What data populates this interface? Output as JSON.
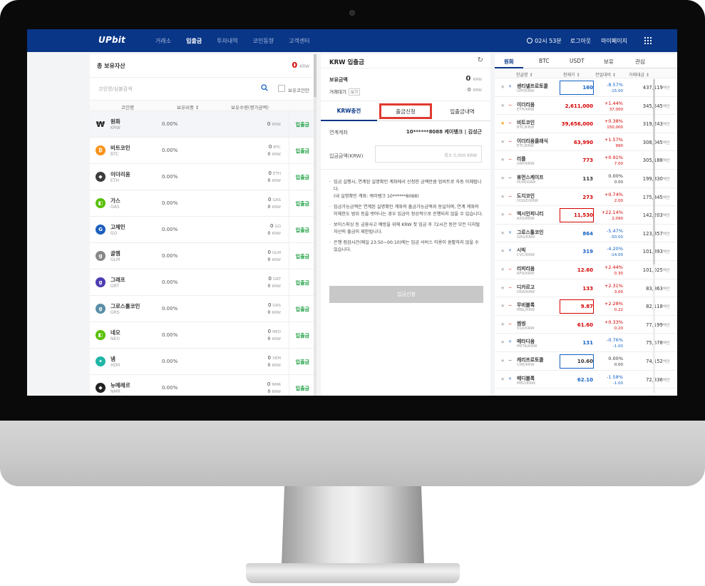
{
  "header": {
    "logo": "UPbit",
    "nav": [
      "거래소",
      "입출금",
      "투자내역",
      "코인동향",
      "고객센터"
    ],
    "active_nav": 1,
    "clock": "02시 53분",
    "logout": "로그아웃",
    "mypage": "마이페이지"
  },
  "assets": {
    "title": "총 보유자산",
    "total_value": "0",
    "total_unit": "KRW",
    "search_placeholder": "코인명/심볼검색",
    "owned_only_label": "보유코인만",
    "columns": [
      "코인명",
      "보유비중 ↕",
      "보유수량(평가금액)"
    ],
    "rows": [
      {
        "name": "원화",
        "symbol": "KRW",
        "pct": "0.00%",
        "amount": "0",
        "unit": "KRW",
        "krw": "",
        "action": "입출금",
        "icon": "won-icon",
        "color": "#222"
      },
      {
        "name": "비트코인",
        "symbol": "BTC",
        "pct": "0.00%",
        "amount": "0",
        "unit": "BTC",
        "krw": "0",
        "action": "입출금",
        "icon": "bitcoin-icon",
        "color": "#f7931a"
      },
      {
        "name": "이더리움",
        "symbol": "ETH",
        "pct": "0.00%",
        "amount": "0",
        "unit": "ETH",
        "krw": "0",
        "action": "입출금",
        "icon": "ethereum-icon",
        "color": "#3c3c3d"
      },
      {
        "name": "가스",
        "symbol": "GAS",
        "pct": "0.00%",
        "amount": "0",
        "unit": "GAS",
        "krw": "0",
        "action": "입출금",
        "icon": "gas-icon",
        "color": "#58bf00"
      },
      {
        "name": "고체인",
        "symbol": "GO",
        "pct": "0.00%",
        "amount": "0",
        "unit": "GO",
        "krw": "0",
        "action": "입출금",
        "icon": "gochain-icon",
        "color": "#1c5fbd"
      },
      {
        "name": "골렘",
        "symbol": "GLM",
        "pct": "0.00%",
        "amount": "0",
        "unit": "GLM",
        "krw": "0",
        "action": "입출금",
        "icon": "golem-icon",
        "color": "#888"
      },
      {
        "name": "그래프",
        "symbol": "GRT",
        "pct": "0.00%",
        "amount": "0",
        "unit": "GRT",
        "krw": "0",
        "action": "입출금",
        "icon": "graph-icon",
        "color": "#4a3bb0"
      },
      {
        "name": "그로스톨코인",
        "symbol": "GRS",
        "pct": "0.00%",
        "amount": "0",
        "unit": "GRS",
        "krw": "0",
        "action": "입출금",
        "icon": "groestlcoin-icon",
        "color": "#5a8fa6"
      },
      {
        "name": "네오",
        "symbol": "NEO",
        "pct": "0.00%",
        "amount": "0",
        "unit": "NEO",
        "krw": "0",
        "action": "입출금",
        "icon": "neo-icon",
        "color": "#58bf00"
      },
      {
        "name": "넴",
        "symbol": "XEM",
        "pct": "0.00%",
        "amount": "0",
        "unit": "XEM",
        "krw": "0",
        "action": "입출금",
        "icon": "nem-icon",
        "color": "#1fb5a6"
      },
      {
        "name": "뉴메레르",
        "symbol": "NMR",
        "pct": "0.00%",
        "amount": "0",
        "unit": "NMR",
        "krw": "0",
        "action": "입출금",
        "icon": "numeraire-icon",
        "color": "#222"
      }
    ]
  },
  "deposit": {
    "title": "KRW 입출금",
    "held_label": "보유금액",
    "held_value": "0",
    "held_unit": "KRW",
    "pending_label": "거래대기",
    "pending_btn": "보기",
    "pending_value": "0",
    "pending_unit": "KRW",
    "tabs": [
      "KRW충전",
      "출금신청",
      "입출금내역"
    ],
    "account_label": "연계계좌",
    "account_value": "10******8088 케이뱅크 | 김성근",
    "amount_label": "입금금액(KRW)",
    "amount_placeholder": "최소 5,000 KRW",
    "notes": [
      "입금 실행시, 연계된 실명확인 계좌에서 신청한 금액만큼 업비트로 자동 이체됩니다.",
      "(내 실명확인 계좌: 케이뱅크 10******8088)",
      "입금가능금액은 연계된 실명확인 계좌의 출금가능금액과 동일하며, 연계 계좌의 이체한도 범위 등을 벗어나는 경우 입금이 정상적으로 진행되지 않을 수 있습니다.",
      "보이스피싱 등 금융사고 예방을 위해 KRW 첫 입금 후 72시간 동안 모든 디지털 자산의 출금이 제한됩니다.",
      "은행 점검시간(매일 23:50~00:10)에는 입금 서비스 이용이 원활하지 않을 수 있습니다."
    ],
    "submit": "입금신청"
  },
  "market": {
    "tabs": [
      "원화",
      "BTC",
      "USDT",
      "보유",
      "관심"
    ],
    "columns": [
      "한글명 ↕",
      "현재가 ↕",
      "전일대비 ↕",
      "거래대금 ↕"
    ],
    "rows": [
      {
        "name": "센티넬프로토콜",
        "pair": "UPP/KRW",
        "price": "160",
        "ch": "-8.57%",
        "chv": "-15.00",
        "vol": "437,119",
        "trend": "blue",
        "box": "dn",
        "star": false
      },
      {
        "name": "이더리움",
        "pair": "ETH/KRW",
        "price": "2,611,000",
        "ch": "+1.44%",
        "chv": "37,000",
        "vol": "345,545",
        "trend": "red",
        "box": "",
        "star": false
      },
      {
        "name": "비트코인",
        "pair": "BTC/KRW",
        "price": "39,656,000",
        "ch": "+0.38%",
        "chv": "150,000",
        "vol": "319,243",
        "trend": "red",
        "box": "",
        "star": true
      },
      {
        "name": "이더리움클래식",
        "pair": "ETC/KRW",
        "price": "63,990",
        "ch": "+1.57%",
        "chv": "990",
        "vol": "308,045",
        "trend": "red",
        "box": "",
        "star": false
      },
      {
        "name": "리플",
        "pair": "XRP/KRW",
        "price": "773",
        "ch": "+0.91%",
        "chv": "7.00",
        "vol": "305,188",
        "trend": "red",
        "box": "",
        "star": false
      },
      {
        "name": "휴먼스케이프",
        "pair": "HUM/KRW",
        "price": "113",
        "ch": "0.00%",
        "chv": "0.00",
        "vol": "199,830",
        "trend": "gray",
        "box": "",
        "star": false
      },
      {
        "name": "도지코인",
        "pair": "DOGE/KRW",
        "price": "273",
        "ch": "+0.74%",
        "chv": "2.00",
        "vol": "175,345",
        "trend": "red",
        "box": "",
        "star": false
      },
      {
        "name": "엑시인피니티",
        "pair": "AXS/KRW",
        "price": "11,530",
        "ch": "+22.14%",
        "chv": "2,090",
        "vol": "142,203",
        "trend": "red",
        "box": "up",
        "star": false
      },
      {
        "name": "그로스톨코인",
        "pair": "GRS/KRW",
        "price": "864",
        "ch": "-5.47%",
        "chv": "-50.00",
        "vol": "123,857",
        "trend": "blue",
        "box": "",
        "star": false
      },
      {
        "name": "시빅",
        "pair": "CVC/KRW",
        "price": "319",
        "ch": "-4.20%",
        "chv": "-14.00",
        "vol": "101,893",
        "trend": "blue",
        "box": "",
        "star": false
      },
      {
        "name": "리피리움",
        "pair": "RFR/KRW",
        "price": "12.60",
        "ch": "+2.44%",
        "chv": "0.30",
        "vol": "101,025",
        "trend": "red",
        "box": "",
        "star": false
      },
      {
        "name": "디카르고",
        "pair": "DKA/KRW",
        "price": "133",
        "ch": "+2.31%",
        "chv": "3.00",
        "vol": "83,863",
        "trend": "red",
        "box": "",
        "star": false
      },
      {
        "name": "무비블록",
        "pair": "MBL/KRW",
        "price": "9.87",
        "ch": "+2.28%",
        "chv": "0.22",
        "vol": "82,118",
        "trend": "red",
        "box": "up",
        "star": false
      },
      {
        "name": "썸씽",
        "pair": "SSX/KRW",
        "price": "61.60",
        "ch": "+0.33%",
        "chv": "0.20",
        "vol": "77,199",
        "trend": "red",
        "box": "",
        "star": false
      },
      {
        "name": "메타디움",
        "pair": "META/KRW",
        "price": "131",
        "ch": "-0.76%",
        "chv": "-1.00",
        "vol": "75,678",
        "trend": "blue",
        "box": "",
        "star": false
      },
      {
        "name": "캐리프로토콜",
        "pair": "CRE/KRW",
        "price": "10.60",
        "ch": "0.00%",
        "chv": "0.00",
        "vol": "74,152",
        "trend": "gray",
        "box": "dn",
        "star": false
      },
      {
        "name": "메디블록",
        "pair": "MED/KRW",
        "price": "62.10",
        "ch": "-1.58%",
        "chv": "-1.00",
        "vol": "72,336",
        "trend": "blue",
        "box": "",
        "star": false
      }
    ],
    "vol_unit": "백만"
  }
}
